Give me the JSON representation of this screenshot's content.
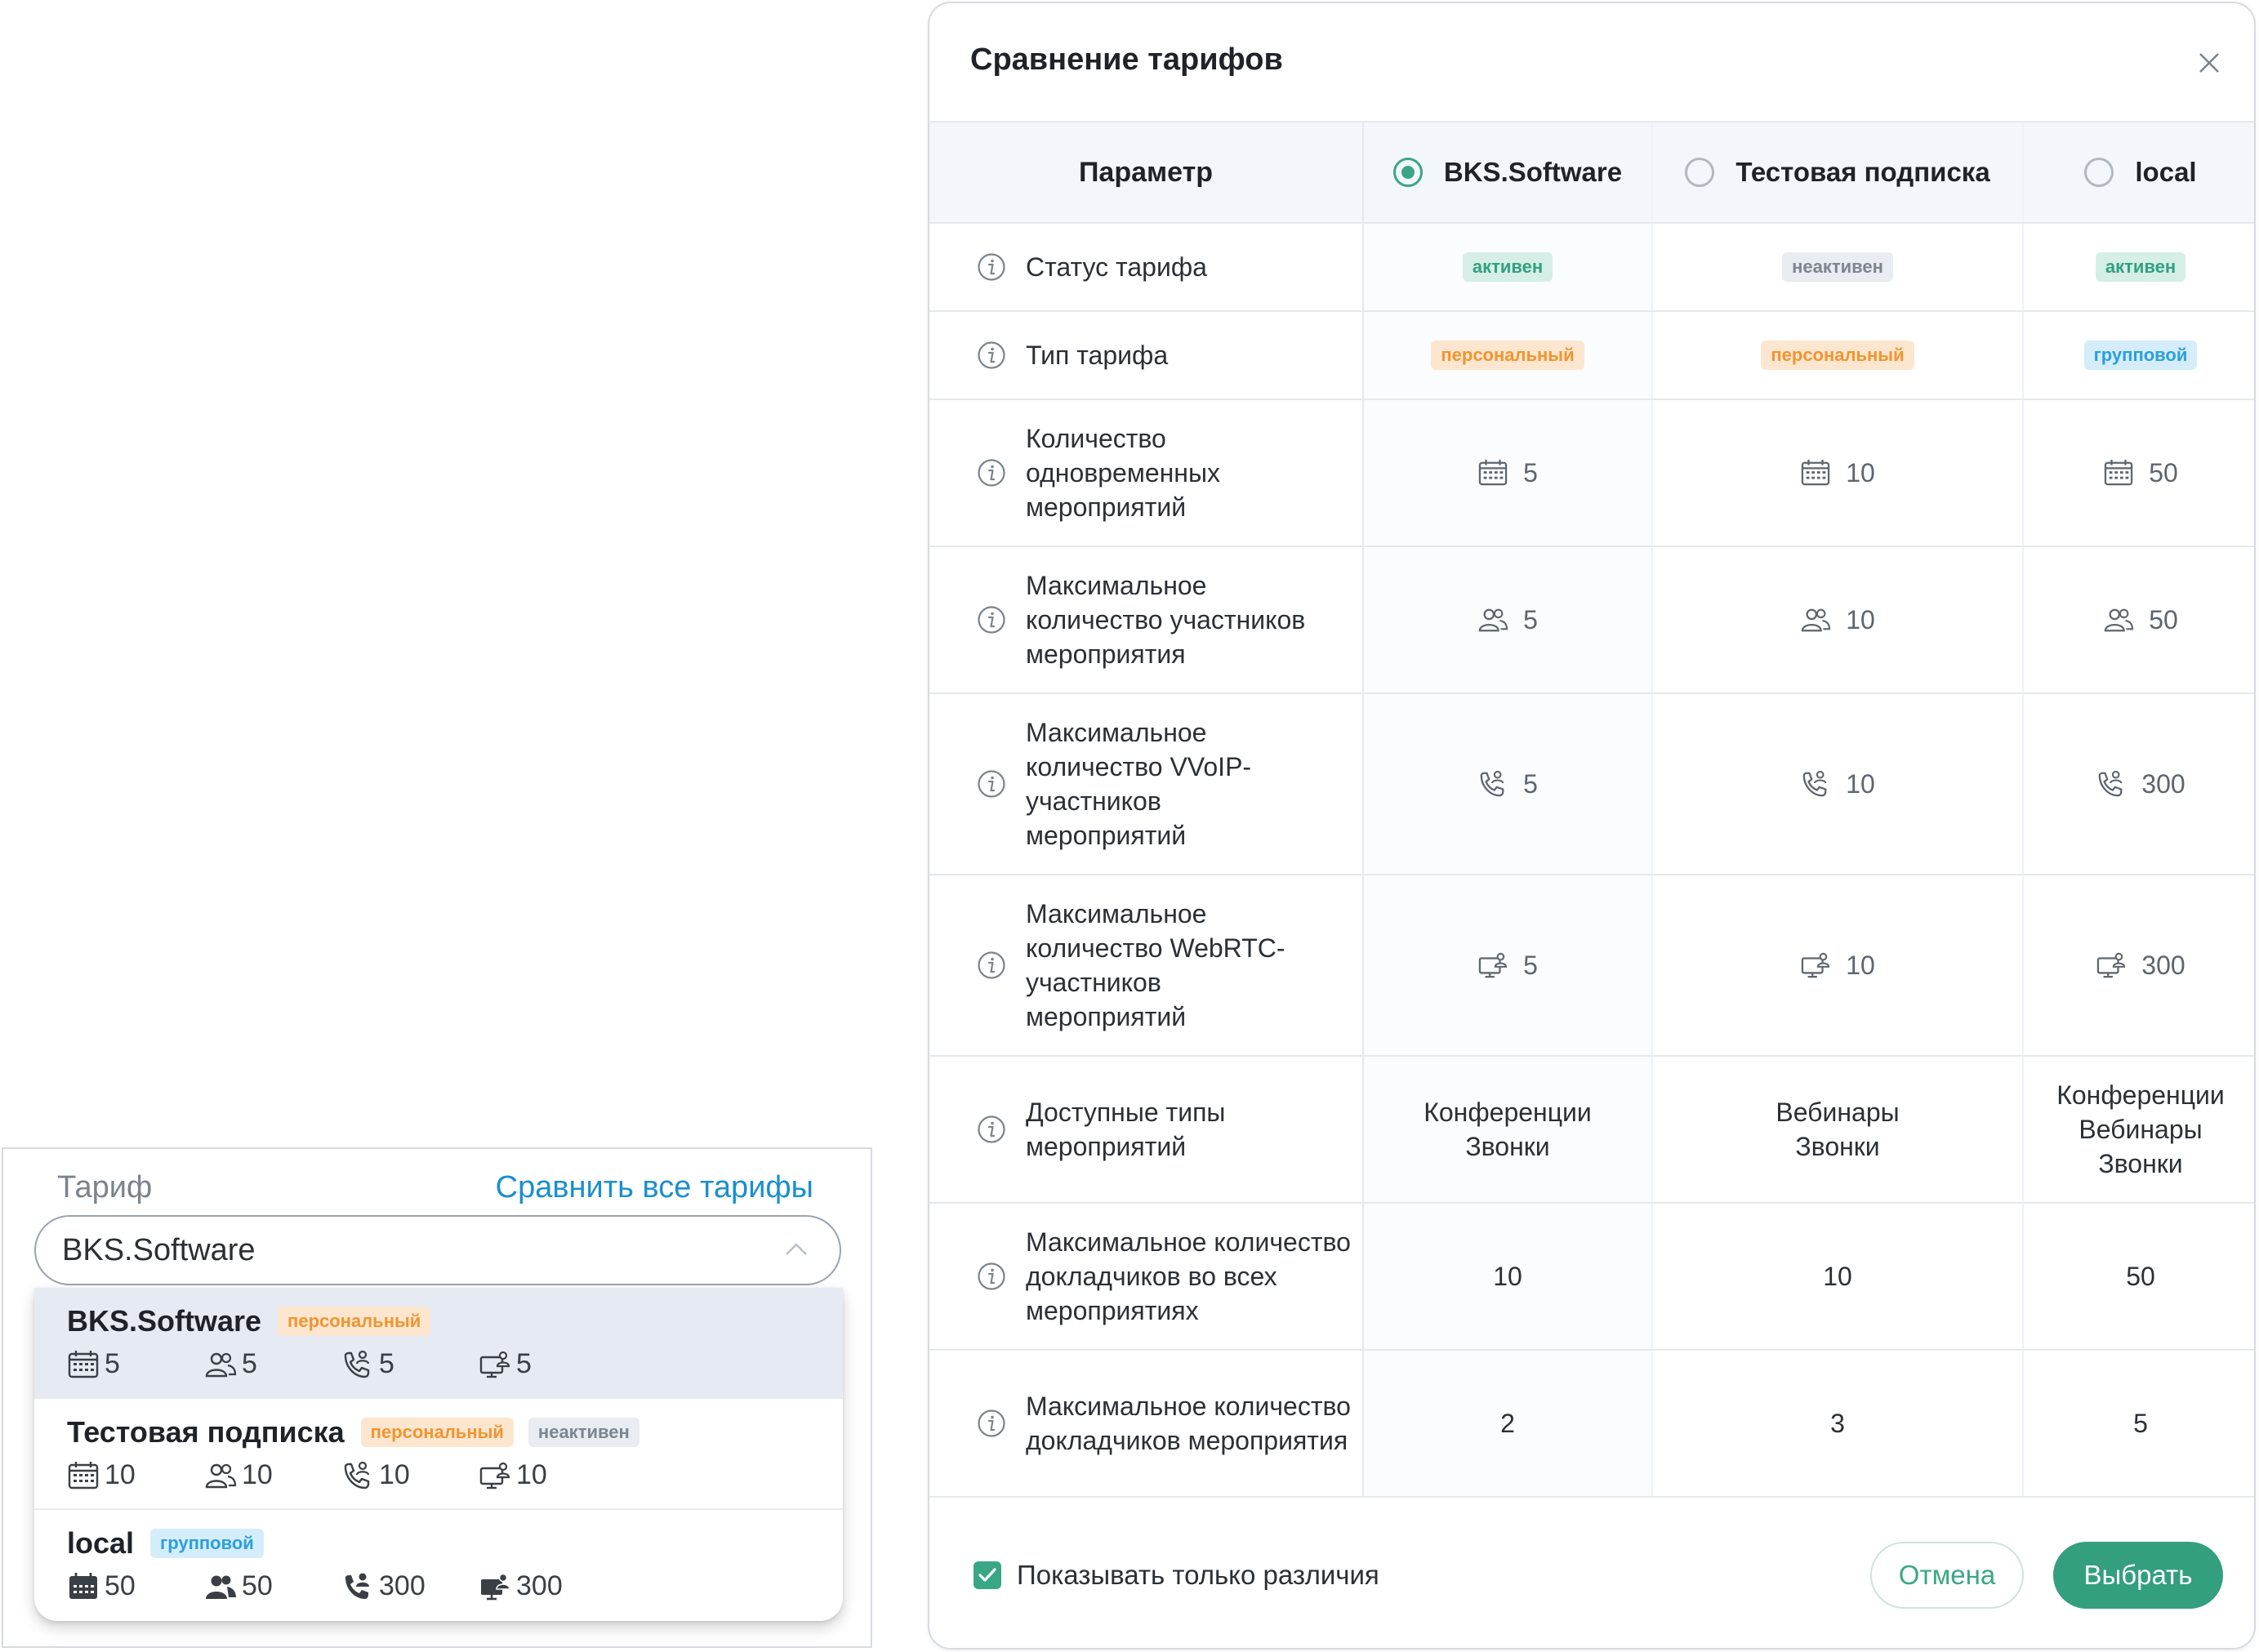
{
  "select": {
    "label": "Тариф",
    "compare_link": "Сравнить все тарифы",
    "value": "BKS.Software",
    "options": [
      {
        "name": "BKS.Software",
        "badges": [
          "персональный"
        ],
        "stats": [
          "5",
          "5",
          "5",
          "5"
        ]
      },
      {
        "name": "Тестовая подписка",
        "badges": [
          "персональный",
          "неактивен"
        ],
        "stats": [
          "10",
          "10",
          "10",
          "10"
        ]
      },
      {
        "name": "local",
        "badges": [
          "групповой"
        ],
        "stats": [
          "50",
          "50",
          "300",
          "300"
        ]
      }
    ]
  },
  "modal": {
    "title": "Сравнение тарифов",
    "header": {
      "param": "Параметр",
      "plans": [
        "BKS.Software",
        "Тестовая подписка",
        "local"
      ],
      "selected_index": 0
    },
    "rows": {
      "status": {
        "label": "Статус тарифа",
        "values": [
          "активен",
          "неактивен",
          "активен"
        ]
      },
      "type": {
        "label": "Тип тарифа",
        "values": [
          "персональный",
          "персональный",
          "групповой"
        ]
      },
      "events": {
        "label": "Количество одновременных мероприятий",
        "values": [
          "5",
          "10",
          "50"
        ]
      },
      "participants": {
        "label": "Максимальное количество участников мероприятия",
        "values": [
          "5",
          "10",
          "50"
        ]
      },
      "voip": {
        "label": "Максимальное количество VVoIP-участников мероприятий",
        "values": [
          "5",
          "10",
          "300"
        ]
      },
      "webrtc": {
        "label": "Максимальное количество WebRTC-участников мероприятий",
        "values": [
          "5",
          "10",
          "300"
        ]
      },
      "event_types": {
        "label": "Доступные типы мероприятий",
        "values": [
          "Конференции\nЗвонки",
          "Вебинары\nЗвонки",
          "Конференции\nВебинары\nЗвонки"
        ]
      },
      "speakers_all": {
        "label": "Максимальное количество докладчиков во всех мероприятиях",
        "values": [
          "10",
          "10",
          "50"
        ]
      },
      "speakers_event": {
        "label": "Максимальное количество докладчиков мероприятия",
        "values": [
          "2",
          "3",
          "5"
        ]
      }
    },
    "footer": {
      "only_diff_label": "Показывать только различия",
      "only_diff_checked": true,
      "cancel": "Отмена",
      "submit": "Выбрать"
    }
  },
  "colors": {
    "accent": "#339f7e",
    "link": "#1a8fcf",
    "badge_personal": "#f0952f",
    "badge_group": "#2a9fdc",
    "badge_active": "#32a07e",
    "badge_inactive": "#7c8590"
  }
}
